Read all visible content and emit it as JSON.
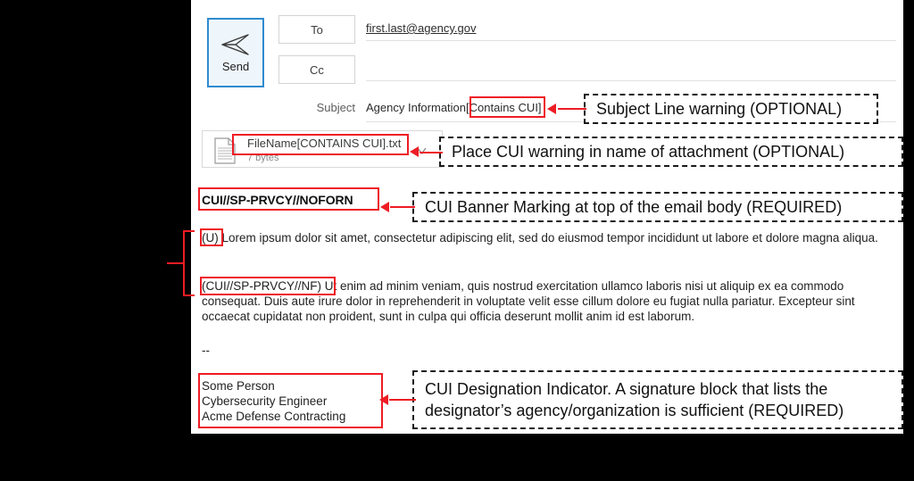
{
  "compose": {
    "send_button_label": "Send",
    "send_icon": "paper-plane-icon",
    "to_label": "To",
    "to_value": "first.last@agency.gov",
    "cc_label": "Cc",
    "cc_value": "",
    "subject_label": "Subject",
    "subject_value": "Agency Information",
    "subject_cui_warning": "[Contains CUI]"
  },
  "attachment": {
    "icon": "document-icon",
    "filename": "FileName[CONTAINS CUI].txt",
    "size": "7 bytes",
    "dropdown_icon": "chevron-down-icon"
  },
  "body": {
    "banner_marking": "CUI//SP-PRVCY//NOFORN",
    "paragraph1_marking": "(U)",
    "paragraph1_text": " Lorem ipsum dolor sit amet, consectetur adipiscing elit, sed do eiusmod tempor incididunt ut labore et dolore magna aliqua.",
    "paragraph2_marking": "(CUI//SP-PRVCY//NF)",
    "paragraph2_text": " Ut enim ad minim veniam, quis nostrud exercitation ullamco laboris nisi ut aliquip ex ea commodo consequat. Duis aute irure dolor in reprehenderit in voluptate velit esse cillum dolore eu fugiat nulla pariatur. Excepteur sint occaecat cupidatat non proident, sunt in culpa qui officia deserunt mollit anim id est laborum.",
    "separator": "--",
    "signature_name": "Some Person",
    "signature_title": "Cybersecurity Engineer",
    "signature_org": "Acme Defense Contracting"
  },
  "annotations": {
    "subject_warning": "Subject Line warning (OPTIONAL)",
    "attachment_warning": "Place CUI warning in name of attachment (OPTIONAL)",
    "banner_marking": "CUI Banner Marking at top of the email body (REQUIRED)",
    "designation_indicator_line1": "CUI Designation Indicator.  A signature block that lists the",
    "designation_indicator_line2": "designator’s agency/organization is sufficient (REQUIRED)"
  },
  "colors": {
    "highlight": "#ee1c24",
    "accent_blue": "#2e8bd0",
    "send_fill": "#eef6fc",
    "background": "#000000",
    "canvas": "#ffffff"
  }
}
